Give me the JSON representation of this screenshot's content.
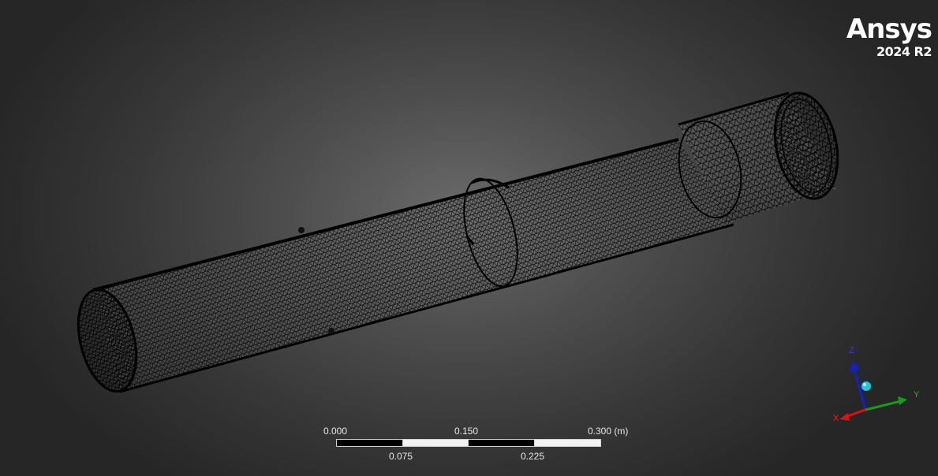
{
  "brand": {
    "logo": "Ansys",
    "version": "2024 R2"
  },
  "triad": {
    "z_label": "Z",
    "y_label": "Y",
    "x_label": "X",
    "colors": {
      "x": "#e01010",
      "y": "#1a9a1a",
      "z": "#1020d0",
      "center": "#22c8d8"
    }
  },
  "scale": {
    "top_labels": [
      "0.000",
      "0.150",
      "0.300 (m)"
    ],
    "bottom_labels": [
      "0.075",
      "0.225"
    ]
  },
  "colors": {
    "mesh_line": "#000000",
    "background_center": "#6a6a6a",
    "background_edge": "#262626"
  }
}
